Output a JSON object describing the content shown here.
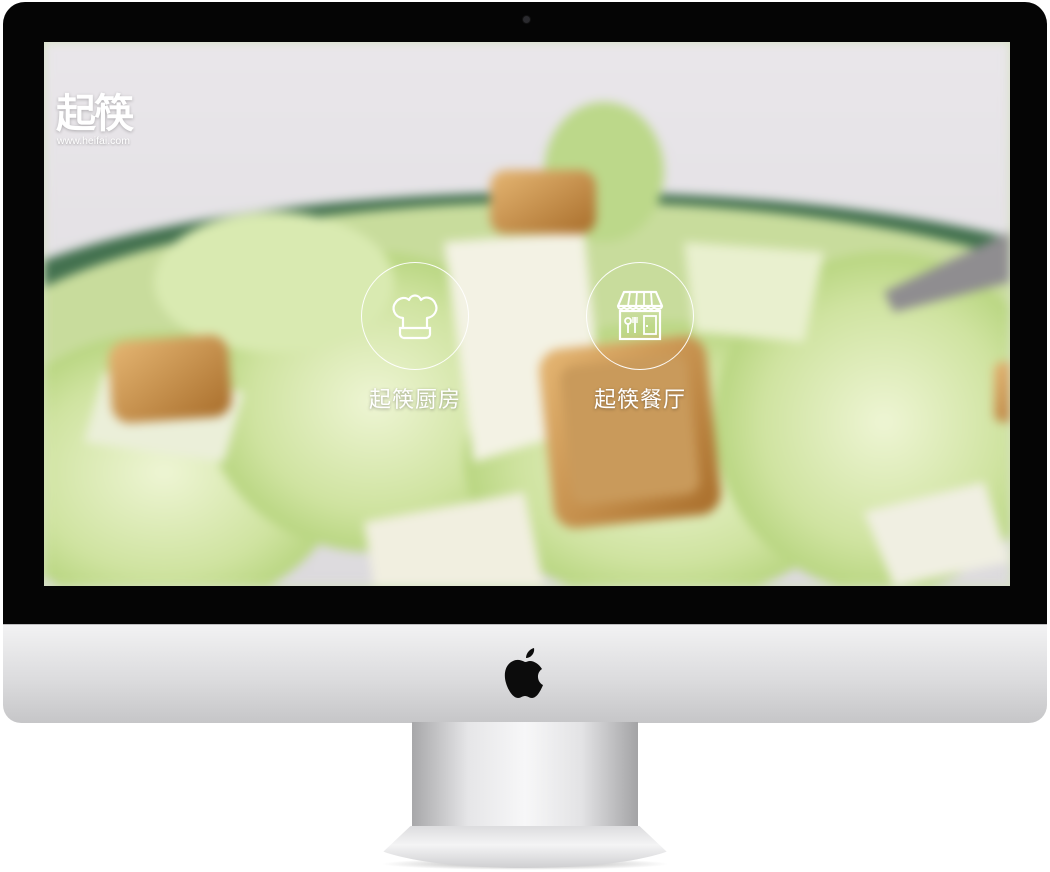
{
  "logo": {
    "title": "起筷",
    "url": "www.heifai.com"
  },
  "nav": [
    {
      "label": "起筷厨房",
      "icon": "chef-hat-icon"
    },
    {
      "label": "起筷餐厅",
      "icon": "storefront-icon"
    }
  ],
  "colors": {
    "bezel": "#050505",
    "screen_overlay_text": "#ffffff",
    "salad_green": "#c9df9d",
    "crouton": "#c58a3e",
    "plate": "#3f6e4e"
  }
}
